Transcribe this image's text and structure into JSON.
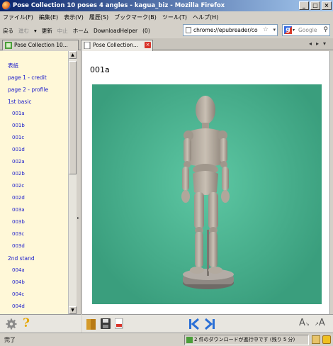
{
  "window": {
    "title": "Pose Collection 10 poses 4 angles - kagua_biz - Mozilla Firefox",
    "minimize": "_",
    "maximize": "□",
    "close": "×"
  },
  "menu": [
    "ファイル(F)",
    "編集(E)",
    "表示(V)",
    "履歴(S)",
    "ブックマーク(B)",
    "ツール(T)",
    "ヘルプ(H)"
  ],
  "nav": {
    "back": "戻る",
    "forward": "進む",
    "reload": "更新",
    "stop": "中止",
    "home": "ホーム",
    "downloadhelper": "DownloadHelper",
    "extra": "(0)",
    "url": "chrome://epubreader/co",
    "search_placeholder": "Google"
  },
  "tabs": [
    {
      "label": "Pose Collection 10...",
      "active": false
    },
    {
      "label": "Pose Collection...",
      "active": true
    }
  ],
  "sidebar": {
    "items": [
      {
        "label": "表紙",
        "level": 1
      },
      {
        "label": "page 1 - credit",
        "level": 1
      },
      {
        "label": "page 2 - profile",
        "level": 1
      },
      {
        "label": "1st basic",
        "level": 1
      },
      {
        "label": "001a",
        "level": 2
      },
      {
        "label": "001b",
        "level": 2
      },
      {
        "label": "001c",
        "level": 2
      },
      {
        "label": "001d",
        "level": 2
      },
      {
        "label": "002a",
        "level": 2
      },
      {
        "label": "002b",
        "level": 2
      },
      {
        "label": "002c",
        "level": 2
      },
      {
        "label": "002d",
        "level": 2
      },
      {
        "label": "003a",
        "level": 2
      },
      {
        "label": "003b",
        "level": 2
      },
      {
        "label": "003c",
        "level": 2
      },
      {
        "label": "003d",
        "level": 2
      },
      {
        "label": "2nd stand",
        "level": 1
      },
      {
        "label": "004a",
        "level": 2
      },
      {
        "label": "004b",
        "level": 2
      },
      {
        "label": "004c",
        "level": 2
      },
      {
        "label": "004d",
        "level": 2
      }
    ]
  },
  "content": {
    "heading": "001a"
  },
  "bottom_tools": {
    "font_smaller": "A",
    "font_larger": "A"
  },
  "status": {
    "left": "完了",
    "download": "2 件のダウンロードが進行中です (残り 5 分)"
  },
  "colors": {
    "link": "#1a1acc",
    "sidebar_bg": "#fff8d8",
    "photo_bg": "#4cb894",
    "nav_arrows": "#2a6fd6"
  }
}
